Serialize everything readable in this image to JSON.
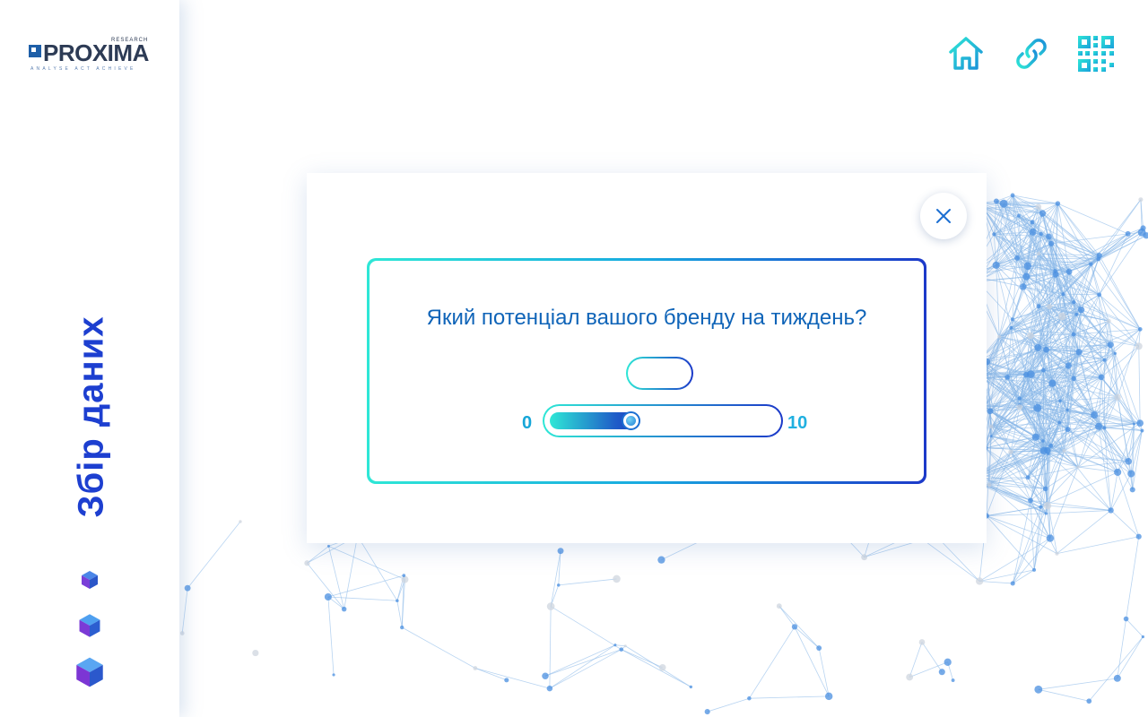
{
  "brand": {
    "name": "PROXIMA",
    "superscript": "RESEARCH",
    "tagline": "ANALYSE   ACT   ACHIEVE"
  },
  "sidebar": {
    "title": "Збір даних",
    "cubes": [
      "cube-icon",
      "cube-icon",
      "cube-icon"
    ]
  },
  "top_nav": {
    "icons": [
      "home-icon",
      "link-icon",
      "qr-code-icon"
    ]
  },
  "modal": {
    "question": "Який потенціал вашого бренду на тиждень?",
    "answer_value": "",
    "scale": {
      "min": "0",
      "max": "10",
      "current_fraction": 0.25
    },
    "close_icon": "close-icon"
  },
  "colors": {
    "accent_cyan": "#2ee7d6",
    "accent_blue": "#1c39c9",
    "title_blue": "#1d3fd0",
    "question_blue": "#0f64b8"
  }
}
